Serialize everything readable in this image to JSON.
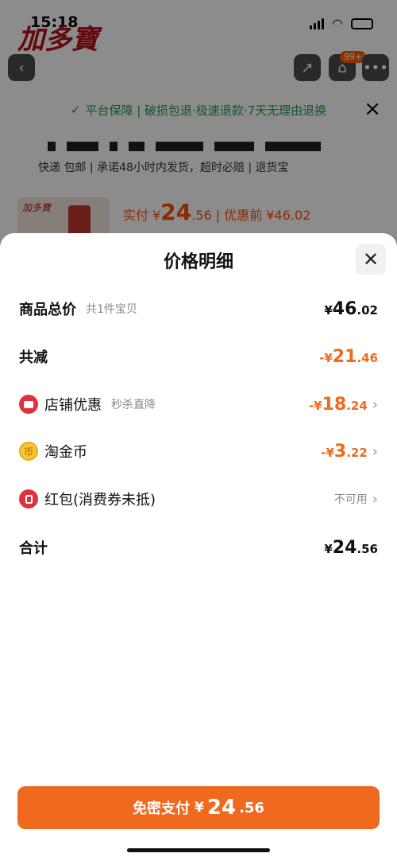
{
  "status_bar": {
    "time": "15:18"
  },
  "background": {
    "brand_logo": "加多寶",
    "cart_badge": "99+",
    "guarantee_text": "平台保障 | 破损包退·极速退款·7天无理由退换",
    "service_text": "快递 包邮 | 承诺48小时内发货，超时必赔 | 退货宝",
    "pay_label": "实付 ¥",
    "pay_int": "24",
    "pay_dec": ".56",
    "before_discount": " | 优惠前 ¥46.02",
    "thumb_logo": "加多寶"
  },
  "modal": {
    "title": "价格明细",
    "rows": [
      {
        "label": "商品总价",
        "sub": "共1件宝贝",
        "cur": "¥",
        "int": "46",
        "dec": ".02"
      },
      {
        "label": "共减",
        "cur": "-¥",
        "int": "21",
        "dec": ".46"
      },
      {
        "label": "店铺优惠",
        "sub": "秒杀直降",
        "cur": "-¥",
        "int": "18",
        "dec": ".24",
        "icon": "store-icon"
      },
      {
        "label": "淘金币",
        "cur": "-¥",
        "int": "3",
        "dec": ".22",
        "icon": "coin-icon"
      },
      {
        "label": "红包(消费券未抵)",
        "status": "不可用",
        "icon": "red-packet-icon"
      },
      {
        "label": "合计",
        "cur": "¥",
        "int": "24",
        "dec": ".56"
      }
    ],
    "pay_button": {
      "text": "免密支付",
      "cur": "¥",
      "int": "24",
      "dec": ".56"
    }
  },
  "colors": {
    "accent": "#ef6a1e",
    "green": "#1f9d55",
    "red": "#e0303a"
  }
}
